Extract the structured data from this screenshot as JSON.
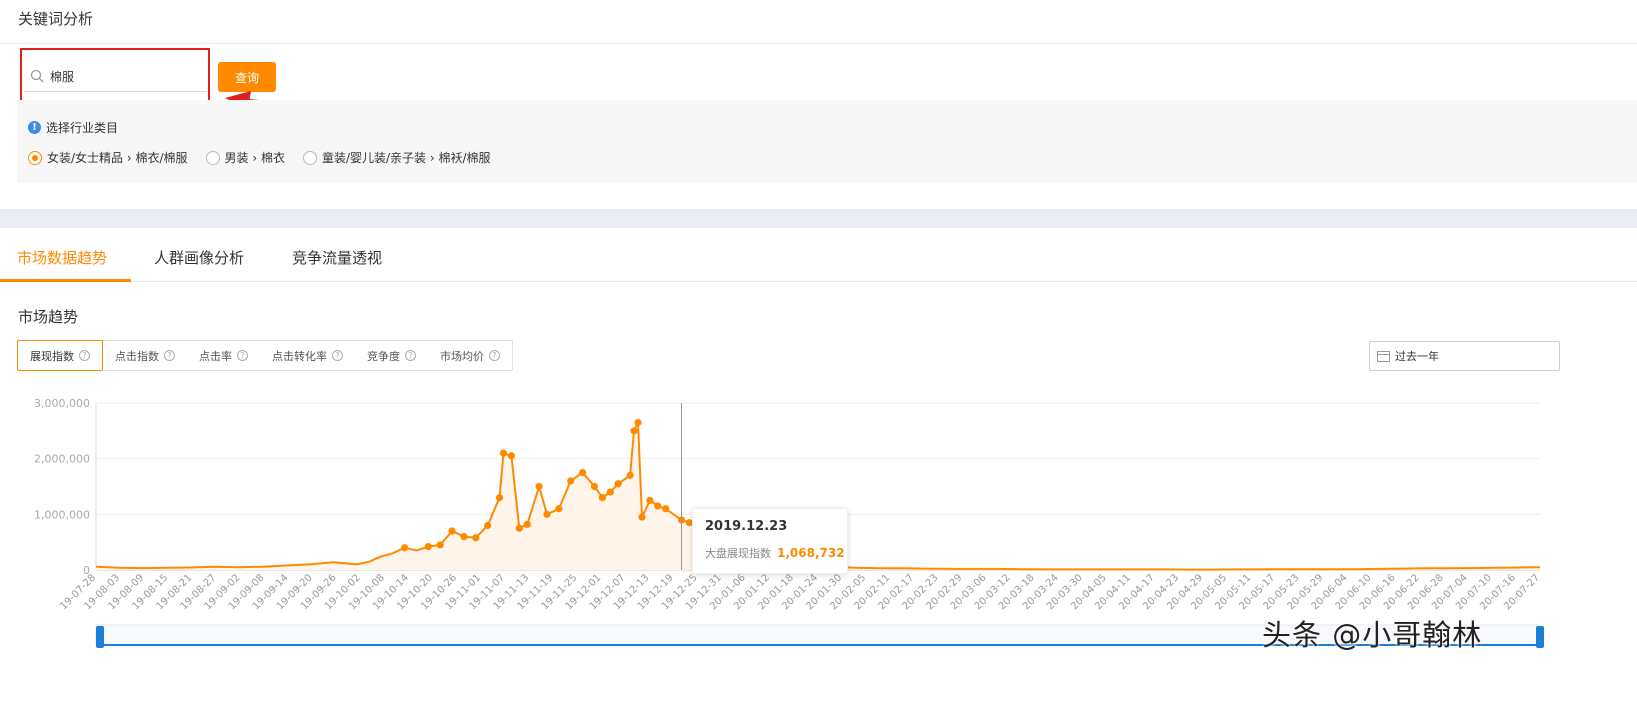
{
  "header": {
    "title": "关键词分析"
  },
  "search": {
    "value": "棉服",
    "button_label": "查询"
  },
  "category": {
    "hint": "选择行业类目",
    "options": [
      {
        "label": "女装/女士精品 › 棉衣/棉服",
        "selected": true
      },
      {
        "label": "男装 › 棉衣",
        "selected": false
      },
      {
        "label": "童装/婴儿装/亲子装 › 棉袄/棉服",
        "selected": false
      }
    ]
  },
  "tabs": [
    {
      "label": "市场数据趋势",
      "active": true
    },
    {
      "label": "人群画像分析",
      "active": false
    },
    {
      "label": "竞争流量透视",
      "active": false
    }
  ],
  "section": {
    "title": "市场趋势"
  },
  "metrics": [
    {
      "label": "展现指数",
      "active": true
    },
    {
      "label": "点击指数",
      "active": false
    },
    {
      "label": "点击率",
      "active": false
    },
    {
      "label": "点击转化率",
      "active": false
    },
    {
      "label": "竞争度",
      "active": false
    },
    {
      "label": "市场均价",
      "active": false
    }
  ],
  "date_range": {
    "label": "过去一年"
  },
  "tooltip": {
    "date": "2019.12.23",
    "label": "大盘展现指数",
    "value": "1,068,732"
  },
  "watermark": "头条 @小哥翰林",
  "colors": {
    "accent": "#ff8a00",
    "highlight": "#e02020",
    "slider": "#1b7fd6"
  },
  "chart_data": {
    "type": "line",
    "series": [
      {
        "name": "大盘展现指数"
      }
    ],
    "ylim": [
      0,
      3000000
    ],
    "yticks": [
      0,
      1000000,
      2000000,
      3000000
    ],
    "ytick_labels": [
      "0",
      "1,000,000",
      "2,000,000",
      "3,000,000"
    ],
    "xtick_labels": [
      "19-07-28",
      "19-08-03",
      "19-08-09",
      "19-08-15",
      "19-08-21",
      "19-08-27",
      "19-09-02",
      "19-09-08",
      "19-09-14",
      "19-09-20",
      "19-09-26",
      "19-10-02",
      "19-10-08",
      "19-10-14",
      "19-10-20",
      "19-10-26",
      "19-11-01",
      "19-11-07",
      "19-11-13",
      "19-11-19",
      "19-11-25",
      "19-12-01",
      "19-12-07",
      "19-12-13",
      "19-12-19",
      "19-12-25",
      "19-12-31",
      "20-01-06",
      "20-01-12",
      "20-01-18",
      "20-01-24",
      "20-01-30",
      "20-02-05",
      "20-02-11",
      "20-02-17",
      "20-02-23",
      "20-02-29",
      "20-03-06",
      "20-03-12",
      "20-03-18",
      "20-03-24",
      "20-03-30",
      "20-04-05",
      "20-04-11",
      "20-04-17",
      "20-04-23",
      "20-04-29",
      "20-05-05",
      "20-05-11",
      "20-05-17",
      "20-05-23",
      "20-05-29",
      "20-06-04",
      "20-06-10",
      "20-06-16",
      "20-06-22",
      "20-06-28",
      "20-07-04",
      "20-07-10",
      "20-07-16",
      "20-07-27"
    ],
    "x_start": "2019-07-28",
    "x_end": "2020-07-27",
    "crosshair_x": "2019-12-23",
    "points": [
      [
        "2019-07-28",
        60000
      ],
      [
        "2019-08-03",
        40000
      ],
      [
        "2019-08-09",
        35000
      ],
      [
        "2019-08-15",
        40000
      ],
      [
        "2019-08-21",
        45000
      ],
      [
        "2019-08-27",
        60000
      ],
      [
        "2019-09-02",
        50000
      ],
      [
        "2019-09-08",
        60000
      ],
      [
        "2019-09-14",
        80000
      ],
      [
        "2019-09-20",
        100000
      ],
      [
        "2019-09-26",
        140000
      ],
      [
        "2019-10-02",
        100000
      ],
      [
        "2019-10-05",
        150000
      ],
      [
        "2019-10-08",
        240000
      ],
      [
        "2019-10-11",
        300000
      ],
      [
        "2019-10-14",
        400000
      ],
      [
        "2019-10-17",
        350000
      ],
      [
        "2019-10-20",
        420000
      ],
      [
        "2019-10-23",
        450000
      ],
      [
        "2019-10-26",
        700000
      ],
      [
        "2019-10-29",
        600000
      ],
      [
        "2019-11-01",
        580000
      ],
      [
        "2019-11-04",
        800000
      ],
      [
        "2019-11-07",
        1300000
      ],
      [
        "2019-11-08",
        2100000
      ],
      [
        "2019-11-10",
        2050000
      ],
      [
        "2019-11-12",
        750000
      ],
      [
        "2019-11-14",
        820000
      ],
      [
        "2019-11-17",
        1500000
      ],
      [
        "2019-11-19",
        1000000
      ],
      [
        "2019-11-22",
        1100000
      ],
      [
        "2019-11-25",
        1600000
      ],
      [
        "2019-11-28",
        1750000
      ],
      [
        "2019-12-01",
        1500000
      ],
      [
        "2019-12-03",
        1300000
      ],
      [
        "2019-12-05",
        1400000
      ],
      [
        "2019-12-07",
        1550000
      ],
      [
        "2019-12-10",
        1700000
      ],
      [
        "2019-12-11",
        2500000
      ],
      [
        "2019-12-12",
        2650000
      ],
      [
        "2019-12-13",
        950000
      ],
      [
        "2019-12-15",
        1250000
      ],
      [
        "2019-12-17",
        1150000
      ],
      [
        "2019-12-19",
        1100000
      ],
      [
        "2019-12-23",
        900000
      ],
      [
        "2019-12-25",
        850000
      ],
      [
        "2019-12-31",
        700000
      ],
      [
        "2020-01-06",
        450000
      ],
      [
        "2020-01-12",
        300000
      ],
      [
        "2020-01-18",
        200000
      ],
      [
        "2020-01-24",
        100000
      ],
      [
        "2020-01-30",
        60000
      ],
      [
        "2020-02-05",
        40000
      ],
      [
        "2020-02-11",
        30000
      ],
      [
        "2020-02-17",
        30000
      ],
      [
        "2020-02-23",
        25000
      ],
      [
        "2020-03-01",
        20000
      ],
      [
        "2020-03-06",
        20000
      ],
      [
        "2020-03-12",
        20000
      ],
      [
        "2020-03-18",
        15000
      ],
      [
        "2020-03-24",
        10000
      ],
      [
        "2020-03-30",
        10000
      ],
      [
        "2020-04-05",
        10000
      ],
      [
        "2020-04-11",
        10000
      ],
      [
        "2020-04-17",
        10000
      ],
      [
        "2020-04-23",
        10000
      ],
      [
        "2020-04-29",
        8000
      ],
      [
        "2020-05-05",
        8000
      ],
      [
        "2020-05-11",
        10000
      ],
      [
        "2020-05-17",
        10000
      ],
      [
        "2020-05-23",
        15000
      ],
      [
        "2020-05-29",
        15000
      ],
      [
        "2020-06-04",
        15000
      ],
      [
        "2020-06-10",
        15000
      ],
      [
        "2020-06-16",
        20000
      ],
      [
        "2020-06-22",
        25000
      ],
      [
        "2020-06-28",
        30000
      ],
      [
        "2020-07-04",
        30000
      ],
      [
        "2020-07-10",
        35000
      ],
      [
        "2020-07-16",
        40000
      ],
      [
        "2020-07-27",
        50000
      ]
    ]
  }
}
